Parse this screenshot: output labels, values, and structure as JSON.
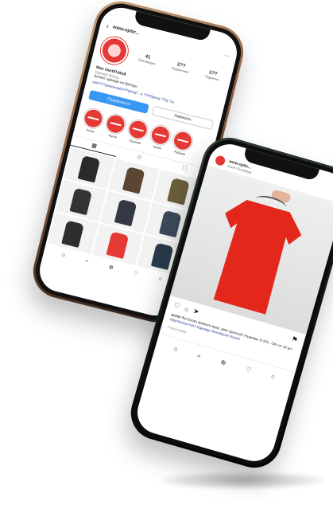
{
  "left_phone": {
    "header": {
      "back_icon": "‹",
      "username": "www.optic...",
      "menu_icon": "⋯"
    },
    "profile": {
      "stats": [
        {
          "num": "41",
          "label": "Публикации"
        },
        {
          "num": "2??",
          "label": "Подписчики"
        },
        {
          "num": "1??",
          "label": "Подписки"
        }
      ],
      "name": "Max Ourt/Л.Мой",
      "category": "Одежда бренд",
      "bio": "Бизнес одежды на бренды",
      "link": "ww?/?/?ромонлайн?/?ренд?...и ??/?бренд ??ру ?ы"
    },
    "actions": {
      "follow": "Подписаться",
      "message": "Написать"
    },
    "highlights": [
      {
        "label": "Новое"
      },
      {
        "label": "Куртки"
      },
      {
        "label": "Пуховики"
      },
      {
        "label": "Брюки"
      },
      {
        "label": "Рубашки"
      }
    ],
    "tabs": [
      "▦",
      "◎",
      "☐"
    ],
    "grid_colors": [
      "#2a2a2a",
      "#5a4632",
      "#6b5e3b",
      "#343434",
      "#333842",
      "#3b4a5a",
      "#2d2f2f",
      "#e53935",
      "#2a3a4a"
    ],
    "bottom_nav": [
      "⌂",
      "⌕",
      "⊕",
      "♡",
      "○"
    ]
  },
  "right_phone": {
    "post": {
      "username": "www.optic...",
      "sub": "Санкт-Петербург",
      "more_icon": "⋯",
      "actions": [
        "♡",
        "○",
        "➤",
        "⚑"
      ],
      "caption_user": "ourtcl",
      "caption": "Футболка прямого кроя, цвет красный. Размеры S-XXL. Опт от 10 шт.",
      "link": "#футболка #опт #одежда #trendstore #ourtcl",
      "time": "2 часа назад"
    },
    "bottom_nav": [
      "⌂",
      "⌕",
      "⊕",
      "♡",
      "○"
    ]
  },
  "colors": {
    "accent_red": "#e53935",
    "ig_blue": "#3897f0",
    "link_blue": "#1a3b8b"
  }
}
